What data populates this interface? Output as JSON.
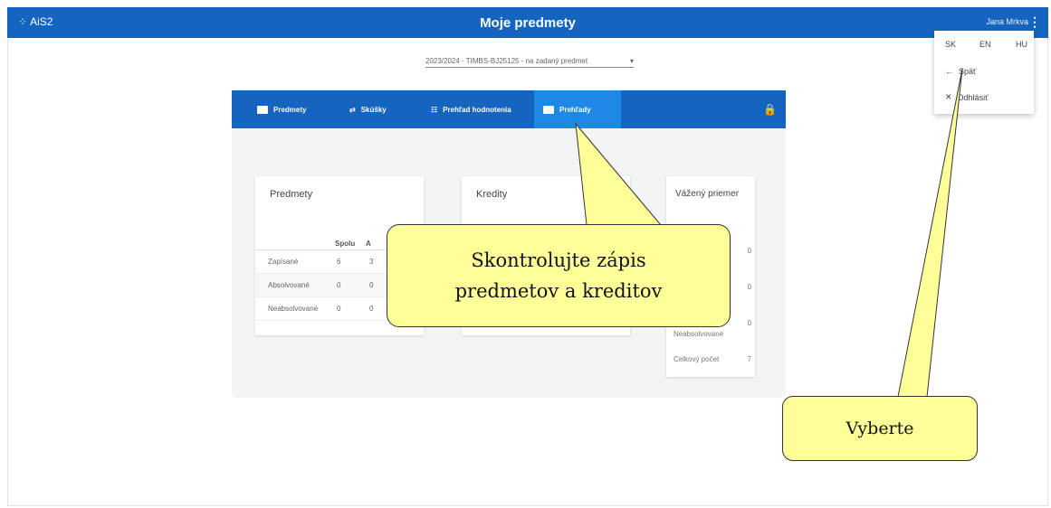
{
  "app": {
    "logo": "AiS2",
    "title": "Moje predmety",
    "user_name": "Jana Mrkva",
    "more": "⋮"
  },
  "menu": {
    "langs": [
      "SK",
      "EN",
      "HU"
    ],
    "back": "Späť",
    "logout": "Odhlásiť"
  },
  "period": {
    "value": "2023/2024 - TIMBS-BJ25125 - na zadaný predmet",
    "caret": "▾"
  },
  "tabs": [
    {
      "label": "Predmety"
    },
    {
      "label": "Skúšky"
    },
    {
      "label": "Prehľad hodnotenia"
    },
    {
      "label": "Prehľady"
    }
  ],
  "cards": {
    "subjects": {
      "title": "Predmety",
      "headers": [
        "Spolu",
        "A"
      ],
      "rows": [
        {
          "label": "Zapísané",
          "total": "6",
          "a": "3"
        },
        {
          "label": "Absolvované",
          "total": "0",
          "a": "0"
        },
        {
          "label": "Neabsolvované",
          "total": "0",
          "a": "0"
        }
      ]
    },
    "credits": {
      "title": "Kredity"
    },
    "study": {
      "title": "Vážený priemer",
      "rows": [
        {
          "label": "",
          "value": "0"
        },
        {
          "label": "",
          "value": "0"
        },
        {
          "label": "Neabsolvované",
          "value": "0"
        },
        {
          "label": "Celkový počet",
          "value": "7"
        }
      ]
    }
  },
  "callouts": {
    "check_line1": "Skontrolujte zápis",
    "check_line2": "predmetov a kreditov",
    "select": "Vyberte"
  },
  "colors": {
    "primary": "#1565c0",
    "active_tab": "#1e88e5",
    "callout": "#ffff99"
  }
}
